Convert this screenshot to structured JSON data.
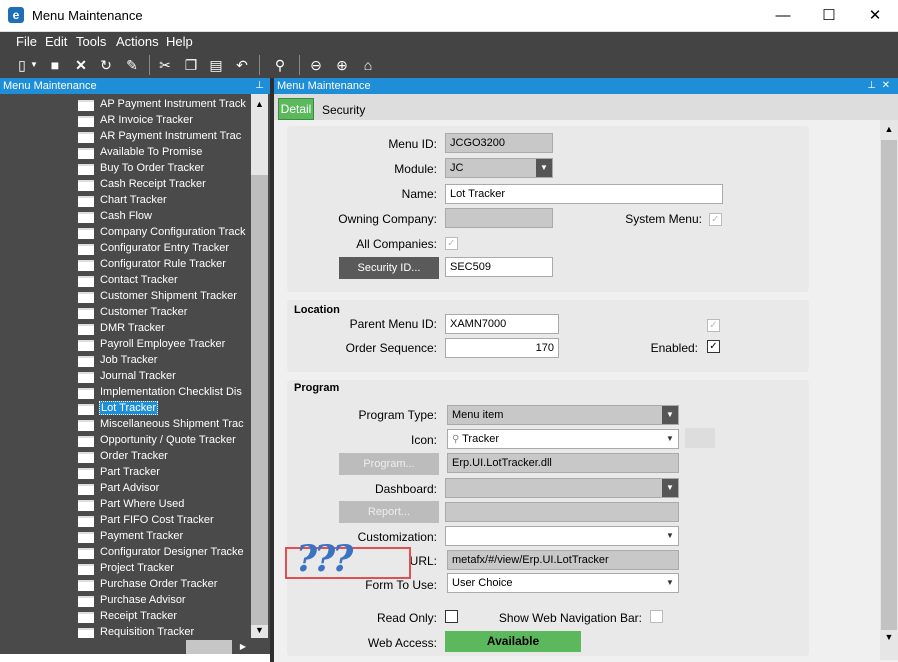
{
  "window": {
    "title": "Menu Maintenance",
    "minimize": "—",
    "maximize": "☐",
    "close": "✕",
    "app_glyph": "e"
  },
  "menubar": [
    "File",
    "Edit",
    "Tools",
    "Actions",
    "Help"
  ],
  "toolbar": {
    "icons": [
      "new-icon",
      "dropdown-arrow-icon",
      "save-icon",
      "delete-icon",
      "refresh-icon",
      "clear-icon",
      "cut-icon",
      "copy-icon",
      "paste-icon",
      "undo-icon",
      "binoculars-icon",
      "back-icon",
      "forward-icon",
      "home-icon"
    ]
  },
  "left_panel": {
    "title": "Menu Maintenance",
    "pin": "⊥",
    "items": [
      "AP Payment Instrument Track",
      "AR Invoice Tracker",
      "AR Payment Instrument Trac",
      "Available To Promise",
      "Buy To Order Tracker",
      "Cash Receipt Tracker",
      "Chart Tracker",
      "Cash Flow",
      "Company Configuration Track",
      "Configurator Entry Tracker",
      "Configurator Rule Tracker",
      "Contact Tracker",
      "Customer Shipment Tracker",
      "Customer Tracker",
      "DMR Tracker",
      "Payroll Employee Tracker",
      "Job Tracker",
      "Journal Tracker",
      "Implementation Checklist Dis",
      "Lot Tracker",
      "Miscellaneous Shipment Trac",
      "Opportunity / Quote Tracker",
      "Order Tracker",
      "Part Tracker",
      "Part Advisor",
      "Part Where Used",
      "Part FIFO Cost Tracker",
      "Payment Tracker",
      "Configurator Designer Tracke",
      "Project Tracker",
      "Purchase Order Tracker",
      "Purchase Advisor",
      "Receipt Tracker",
      "Requisition Tracker"
    ],
    "selected": "Lot Tracker"
  },
  "right_panel": {
    "title": "Menu Maintenance",
    "pin": "⊥",
    "close": "✕"
  },
  "tabs": {
    "detail": "Detail",
    "security": "Security"
  },
  "form": {
    "menu_id_label": "Menu ID:",
    "menu_id": "JCGO3200",
    "module_label": "Module:",
    "module": "JC",
    "name_label": "Name:",
    "name": "Lot Tracker",
    "owning_company_label": "Owning Company:",
    "owning_company": "",
    "system_menu_label": "System Menu:",
    "system_menu_checked": true,
    "all_companies_label": "All Companies:",
    "all_companies_checked": true,
    "security_id_button": "Security ID...",
    "security_id": "SEC509",
    "location_title": "Location",
    "parent_menu_id_label": "Parent Menu ID:",
    "parent_menu_id": "XAMN7000",
    "order_sequence_label": "Order Sequence:",
    "order_sequence": "170",
    "enabled_label": "Enabled:",
    "enabled_checked": true,
    "location_extra_checked": true,
    "program_title": "Program",
    "program_type_label": "Program Type:",
    "program_type": "Menu item",
    "icon_label": "Icon:",
    "icon_value": "Tracker",
    "program_button": "Program...",
    "program": "Erp.UI.LotTracker.dll",
    "dashboard_label": "Dashboard:",
    "dashboard": "",
    "report_button": "Report...",
    "report": "",
    "customization_label": "Customization:",
    "customization": "",
    "url_label": "URL:",
    "url": "metafx/#/view/Erp.UI.LotTracker",
    "form_to_use_label": "Form To Use:",
    "form_to_use": "User Choice",
    "read_only_label": "Read Only:",
    "read_only_checked": false,
    "show_web_nav_label": "Show Web Navigation Bar:",
    "show_web_nav_checked": false,
    "web_access_label": "Web Access:",
    "web_access": "Available"
  },
  "annotation": {
    "text": "???"
  },
  "colors": {
    "accent": "#1f8ed8",
    "tab_active": "#5cb85c",
    "available": "#5cb85c",
    "annotation_border": "#e05050",
    "qmarks": "#3b73c4"
  }
}
